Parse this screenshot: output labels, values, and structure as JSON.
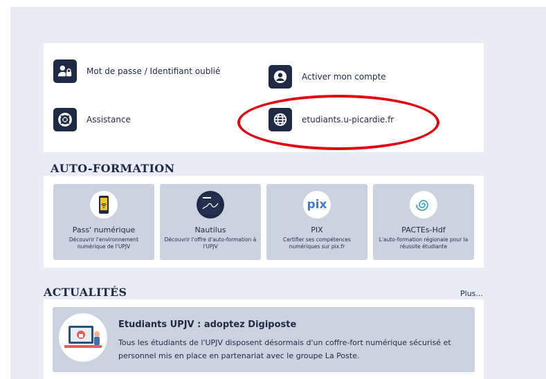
{
  "quick_links": [
    {
      "label": "Mot de passe / Identifiant oublié",
      "icon": "user-lock-icon"
    },
    {
      "label": "Activer mon compte",
      "icon": "user-circle-icon"
    },
    {
      "label": "Assistance",
      "icon": "lifebuoy-icon"
    },
    {
      "label": "etudiants.u-picardie.fr",
      "icon": "globe-icon"
    }
  ],
  "autoformation": {
    "title": "AUTO-FORMATION",
    "tiles": [
      {
        "title": "Pass' numérique",
        "desc": "Découvrir l'environnement numérique de l'UPJV",
        "icon": "phone-wifi-icon"
      },
      {
        "title": "Nautilus",
        "desc": "Découvrir l'offre d'auto-formation à l'UPJV",
        "icon": "nautilus-logo-icon"
      },
      {
        "title": "PIX",
        "desc": "Certifier ses compétences numériques sur pix.fr",
        "icon": "pix-logo-icon",
        "logo_text": "pix"
      },
      {
        "title": "PACTEs-Hdf",
        "desc": "L'auto-formation régionale pour la réussite étudiante",
        "icon": "spiral-icon"
      }
    ]
  },
  "actualites": {
    "title": "ACTUALITÉS",
    "more_label": "Plus...",
    "items": [
      {
        "title": "Etudiants UPJV : adoptez Digiposte",
        "body": "Tous les étudiants de l'UPJV disposent désormais d'un coffre-fort numérique sécurisé et personnel mis en place en partenariat avec le groupe La Poste."
      }
    ]
  },
  "colors": {
    "accent_dark": "#1f2a44",
    "highlight_red": "#e30613",
    "tile_bg": "#ccd3e0",
    "page_bg": "#e9ebf5"
  }
}
